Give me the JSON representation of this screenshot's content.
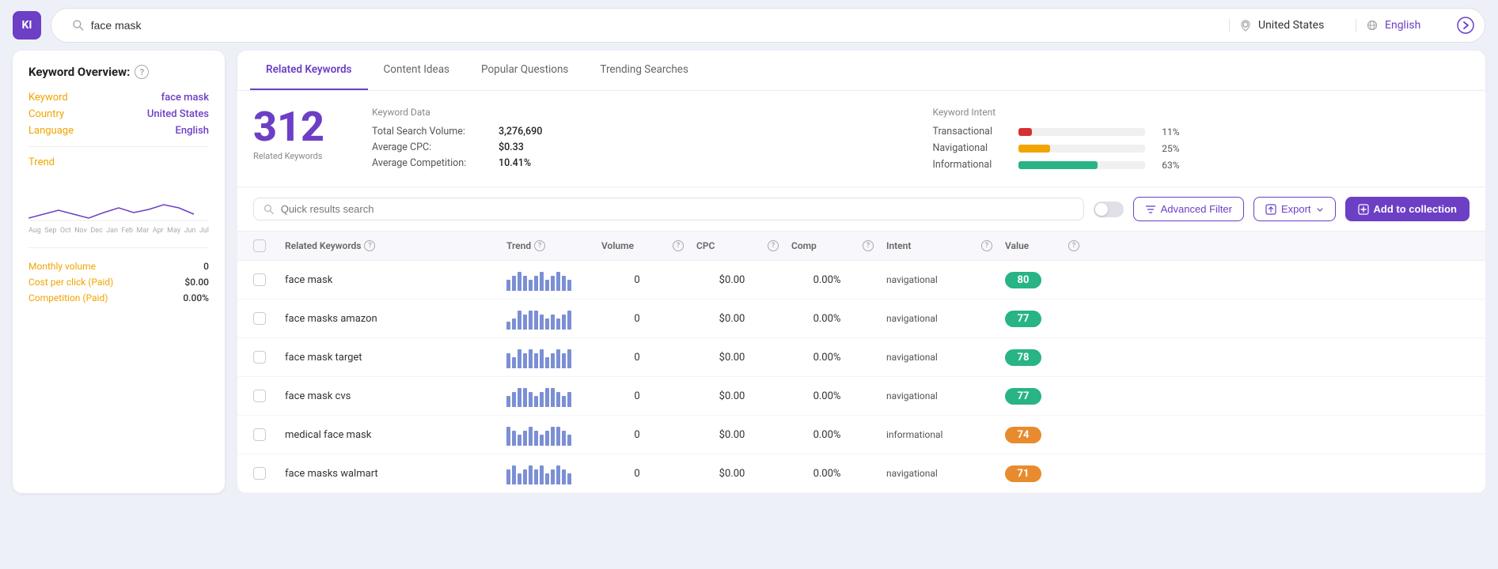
{
  "app": {
    "logo": "KI"
  },
  "searchbar": {
    "query": "face mask",
    "query_placeholder": "face mask",
    "country": "United States",
    "language": "English",
    "search_icon": "🔍",
    "location_icon": "📍",
    "language_icon": "💬",
    "go_icon": "→"
  },
  "sidebar": {
    "title": "Keyword Overview:",
    "help_icon": "?",
    "rows": [
      {
        "label": "Keyword",
        "value": "face mask"
      },
      {
        "label": "Country",
        "value": "United States"
      },
      {
        "label": "Language",
        "value": "English"
      }
    ],
    "trend_label": "Trend",
    "x_labels": [
      "Aug",
      "Sep",
      "Oct",
      "Nov",
      "Dec",
      "Jan",
      "Feb",
      "Mar",
      "Apr",
      "May",
      "Jun",
      "Jul"
    ],
    "stats": [
      {
        "label": "Monthly volume",
        "value": "0"
      },
      {
        "label": "Cost per click (Paid)",
        "value": "$0.00"
      },
      {
        "label": "Competition (Paid)",
        "value": "0.00%"
      }
    ]
  },
  "tabs": [
    {
      "label": "Related Keywords",
      "active": true
    },
    {
      "label": "Content Ideas",
      "active": false
    },
    {
      "label": "Popular Questions",
      "active": false
    },
    {
      "label": "Trending Searches",
      "active": false
    }
  ],
  "keyword_data": {
    "section_title": "Keyword Data",
    "count": "312",
    "count_label": "Related Keywords",
    "rows": [
      {
        "label": "Total Search Volume:",
        "value": "3,276,690"
      },
      {
        "label": "Average CPC:",
        "value": "$0.33"
      },
      {
        "label": "Average Competition:",
        "value": "10.41%"
      }
    ]
  },
  "keyword_intent": {
    "section_title": "Keyword Intent",
    "rows": [
      {
        "label": "Transactional",
        "color": "#d63030",
        "pct": 11,
        "pct_label": "11%"
      },
      {
        "label": "Navigational",
        "color": "#f0a500",
        "pct": 25,
        "pct_label": "25%"
      },
      {
        "label": "Informational",
        "color": "#28b485",
        "pct": 63,
        "pct_label": "63%"
      }
    ]
  },
  "toolbar": {
    "search_placeholder": "Quick results search",
    "advanced_filter_label": "Advanced Filter",
    "export_label": "Export",
    "add_collection_label": "Add to collection"
  },
  "table": {
    "headers": [
      "Related Keywords",
      "Trend",
      "Volume",
      "CPC",
      "Comp",
      "Intent",
      "Value"
    ],
    "rows": [
      {
        "keyword": "face mask",
        "trend_bars": [
          3,
          4,
          5,
          4,
          3,
          4,
          5,
          3,
          4,
          5,
          4,
          3
        ],
        "volume": "0",
        "cpc": "$0.00",
        "comp": "0.00%",
        "intent": "navigational",
        "value": "80",
        "value_color": "green"
      },
      {
        "keyword": "face masks amazon",
        "trend_bars": [
          2,
          3,
          5,
          4,
          5,
          5,
          4,
          3,
          4,
          3,
          4,
          5
        ],
        "volume": "0",
        "cpc": "$0.00",
        "comp": "0.00%",
        "intent": "navigational",
        "value": "77",
        "value_color": "green"
      },
      {
        "keyword": "face mask target",
        "trend_bars": [
          4,
          3,
          5,
          4,
          5,
          4,
          5,
          3,
          4,
          5,
          4,
          5
        ],
        "volume": "0",
        "cpc": "$0.00",
        "comp": "0.00%",
        "intent": "navigational",
        "value": "78",
        "value_color": "green"
      },
      {
        "keyword": "face mask cvs",
        "trend_bars": [
          3,
          4,
          5,
          5,
          4,
          3,
          4,
          5,
          5,
          4,
          3,
          4
        ],
        "volume": "0",
        "cpc": "$0.00",
        "comp": "0.00%",
        "intent": "navigational",
        "value": "77",
        "value_color": "green"
      },
      {
        "keyword": "medical face mask",
        "trend_bars": [
          5,
          4,
          3,
          4,
          5,
          4,
          3,
          4,
          5,
          5,
          4,
          3
        ],
        "volume": "0",
        "cpc": "$0.00",
        "comp": "0.00%",
        "intent": "informational",
        "value": "74",
        "value_color": "orange"
      },
      {
        "keyword": "face masks walmart",
        "trend_bars": [
          4,
          5,
          3,
          4,
          5,
          4,
          5,
          3,
          4,
          5,
          4,
          3
        ],
        "volume": "0",
        "cpc": "$0.00",
        "comp": "0.00%",
        "intent": "navigational",
        "value": "71",
        "value_color": "orange"
      }
    ]
  },
  "colors": {
    "brand_purple": "#6c3fc5",
    "orange": "#f0a500",
    "green": "#28b485",
    "red": "#d63030"
  }
}
